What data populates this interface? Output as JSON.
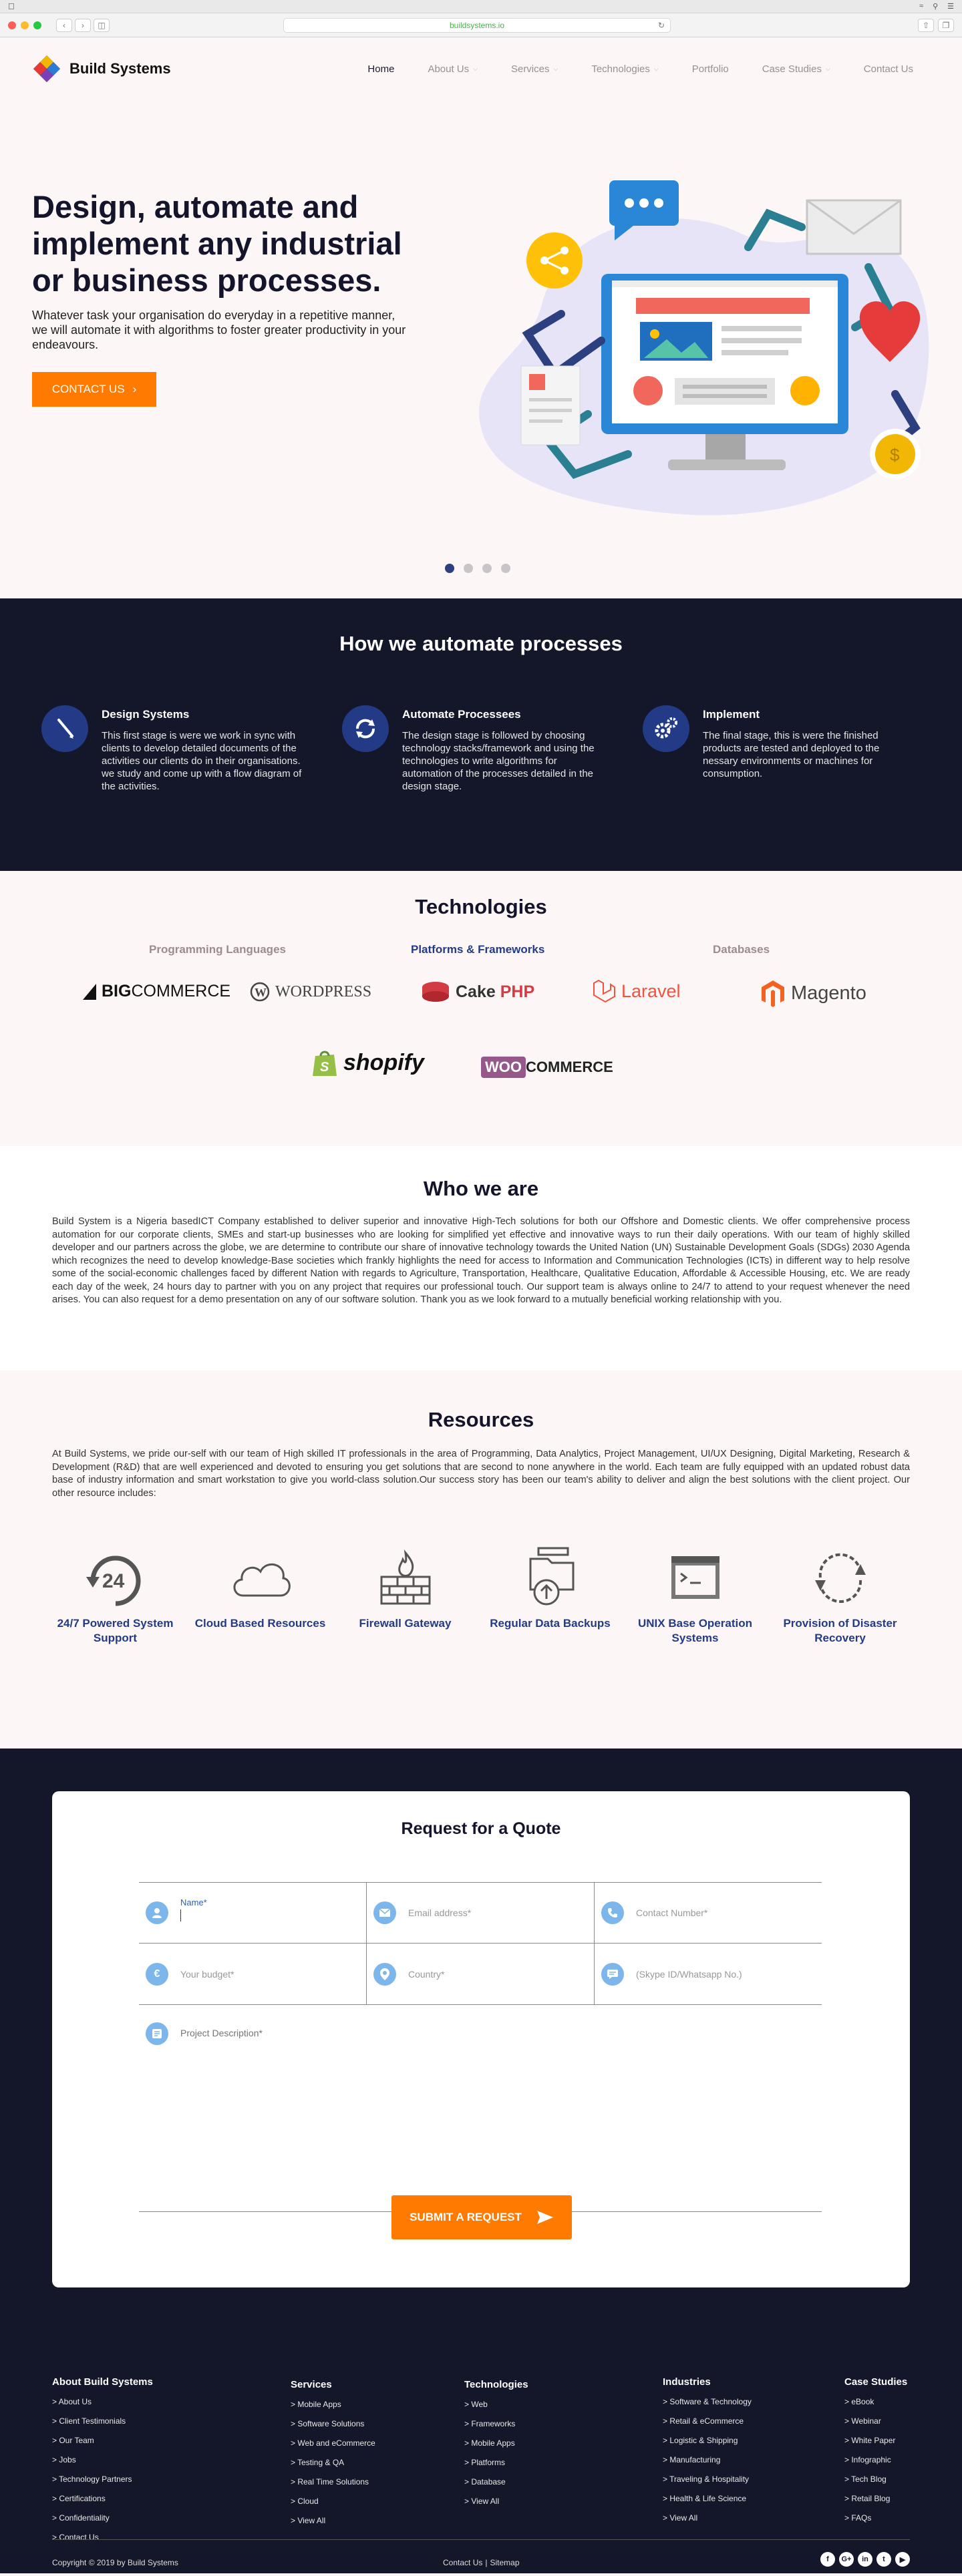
{
  "browser": {
    "url": "buildsystems.io"
  },
  "header": {
    "brand": "Build Systems",
    "nav": [
      {
        "label": "Home",
        "active": true,
        "dropdown": false
      },
      {
        "label": "About Us",
        "dropdown": true
      },
      {
        "label": "Services",
        "dropdown": true
      },
      {
        "label": "Technologies",
        "dropdown": true
      },
      {
        "label": "Portfolio",
        "dropdown": false
      },
      {
        "label": "Case Studies",
        "dropdown": true
      },
      {
        "label": "Contact Us",
        "dropdown": false
      }
    ]
  },
  "hero": {
    "title": "Design, automate and implement any industrial or business processes.",
    "subtitle": "Whatever task your organisation do everyday in a repetitive manner, we will automate it with algorithms to foster greater productivity in your endeavours.",
    "cta": "CONTACT US",
    "slides": 4,
    "active_slide": 1
  },
  "process": {
    "title": "How we automate processes",
    "steps": [
      {
        "title": "Design Systems",
        "text": "This first stage is were we work in sync with clients to develop detailed documents of the activities our clients do in their organisations. we study and come up with a flow diagram of the activities."
      },
      {
        "title": "Automate Processees",
        "text": "The design stage is followed by choosing technology stacks/framework and using the technologies to write algorithms for automation of the processes detailed in the design stage."
      },
      {
        "title": "Implement",
        "text": "The final stage, this is were the finished products are tested and deployed to the nessary environments or machines for consumption."
      }
    ]
  },
  "technologies": {
    "title": "Technologies",
    "tabs": [
      {
        "label": "Programming Languages",
        "active": false
      },
      {
        "label": "Platforms & Frameworks",
        "active": true
      },
      {
        "label": "Databases",
        "active": false
      }
    ],
    "brands": {
      "bigcommerce": {
        "big": "BIG",
        "rest": "COMMERCE"
      },
      "wordpress": "WORDPRESS",
      "cakephp": {
        "cake": "Cake",
        "php": "PHP"
      },
      "laravel": "Laravel",
      "magento": "Magento",
      "shopify": "shopify",
      "woocommerce": {
        "woo": "WOO",
        "rest": "COMMERCE"
      }
    }
  },
  "who": {
    "title": "Who we are",
    "text": "Build System is a Nigeria basedICT Company established to deliver superior and innovative High-Tech solutions for both our Offshore and Domestic clients. We offer comprehensive process automation for our corporate clients, SMEs and start-up businesses who are looking for simplified yet effective and innovative ways to run their daily operations. With our team of highly skilled developer and our partners across the globe, we are determine to contribute our share of innovative technology towards the United Nation (UN) Sustainable Development Goals (SDGs) 2030 Agenda which recognizes the need to develop knowledge-Base societies which frankly highlights the need for access to Information and Communication Technologies (ICTs) in different way to help resolve some of the social-economic challenges faced by different Nation with regards to Agriculture, Transportation, Healthcare, Qualitative Education, Affordable & Accessible Housing, etc. We are ready each day of the week, 24 hours day to partner with you on any project that requires our professional touch. Our support team is always online to 24/7 to attend to your request whenever the need arises. You can also request for a demo presentation on any of our software solution. Thank you as we look forward to a mutually beneficial working relationship with you."
  },
  "resources": {
    "title": "Resources",
    "text": "At Build Systems, we pride our-self with our team of High skilled IT professionals in the area of Programming, Data Analytics, Project Management, UI/UX Designing, Digital Marketing, Research & Development (R&D) that are well experienced and devoted to ensuring you get solutions that are second to none anywhere in the world. Each team are fully equipped with an updated robust data base of industry information and smart workstation to give you world-class solution.Our success story has been our team's ability to deliver and align the best solutions with the client project. Our other resource includes:",
    "badge_24": "24",
    "items": [
      {
        "label": "24/7 Powered System Support",
        "icon": "clock-24-icon"
      },
      {
        "label": "Cloud Based Resources",
        "icon": "cloud-icon"
      },
      {
        "label": "Firewall Gateway",
        "icon": "firewall-icon"
      },
      {
        "label": "Regular Data Backups",
        "icon": "backup-icon"
      },
      {
        "label": "UNIX Base Operation Systems",
        "icon": "terminal-icon"
      },
      {
        "label": "Provision of Disaster Recovery",
        "icon": "recovery-icon"
      }
    ]
  },
  "quote": {
    "title": "Request for a Quote",
    "fields": {
      "name_label": "Name*",
      "email": "Email address*",
      "contact": "Contact Number*",
      "budget": "Your budget*",
      "country": "Country*",
      "skype": "(Skype ID/Whatsapp No.)",
      "description": "Project Description*"
    },
    "submit": "SUBMIT A REQUEST"
  },
  "footer": {
    "columns": [
      {
        "title": "About Build Systems",
        "links": [
          "> About Us",
          "> Client Testimonials",
          "> Our Team",
          "> Jobs",
          "> Technology Partners",
          "> Certifications",
          "> Confidentiality",
          "> Contact Us"
        ]
      },
      {
        "title": "Services",
        "links": [
          "> Mobile Apps",
          "> Software Solutions",
          "> Web and eCommerce",
          "> Testing & QA",
          "> Real Time Solutions",
          "> Cloud",
          "> View All"
        ]
      },
      {
        "title": "Technologies",
        "links": [
          "> Web",
          "> Frameworks",
          "> Mobile Apps",
          "> Platforms",
          "> Database",
          "> View All"
        ]
      },
      {
        "title": "Industries",
        "links": [
          "> Software & Technology",
          "> Retail & eCommerce",
          "> Logistic & Shipping",
          "> Manufacturing",
          "> Traveling & Hospitality",
          "> Health & Life Science",
          "> View All"
        ]
      },
      {
        "title": "Case Studies",
        "links": [
          "> eBook",
          "> Webinar",
          "> White Paper",
          "> Infographic",
          "> Tech Blog",
          "> Retail Blog",
          "> FAQs"
        ]
      }
    ],
    "copyright": "Copyright © 2019 by Build Systems",
    "contact_link": "Contact Us",
    "separator": "|",
    "sitemap_link": "Sitemap",
    "socials": [
      {
        "glyph": "f",
        "icon": "facebook-icon"
      },
      {
        "glyph": "G+",
        "icon": "google-plus-icon"
      },
      {
        "glyph": "in",
        "icon": "linkedin-icon"
      },
      {
        "glyph": "t",
        "icon": "twitter-icon"
      },
      {
        "glyph": "▶",
        "icon": "youtube-icon"
      }
    ]
  },
  "colors": {
    "accent": "#ff7a00",
    "navy": "#14172a",
    "brand_blue": "#233b86",
    "background": "#fdf6f6"
  }
}
